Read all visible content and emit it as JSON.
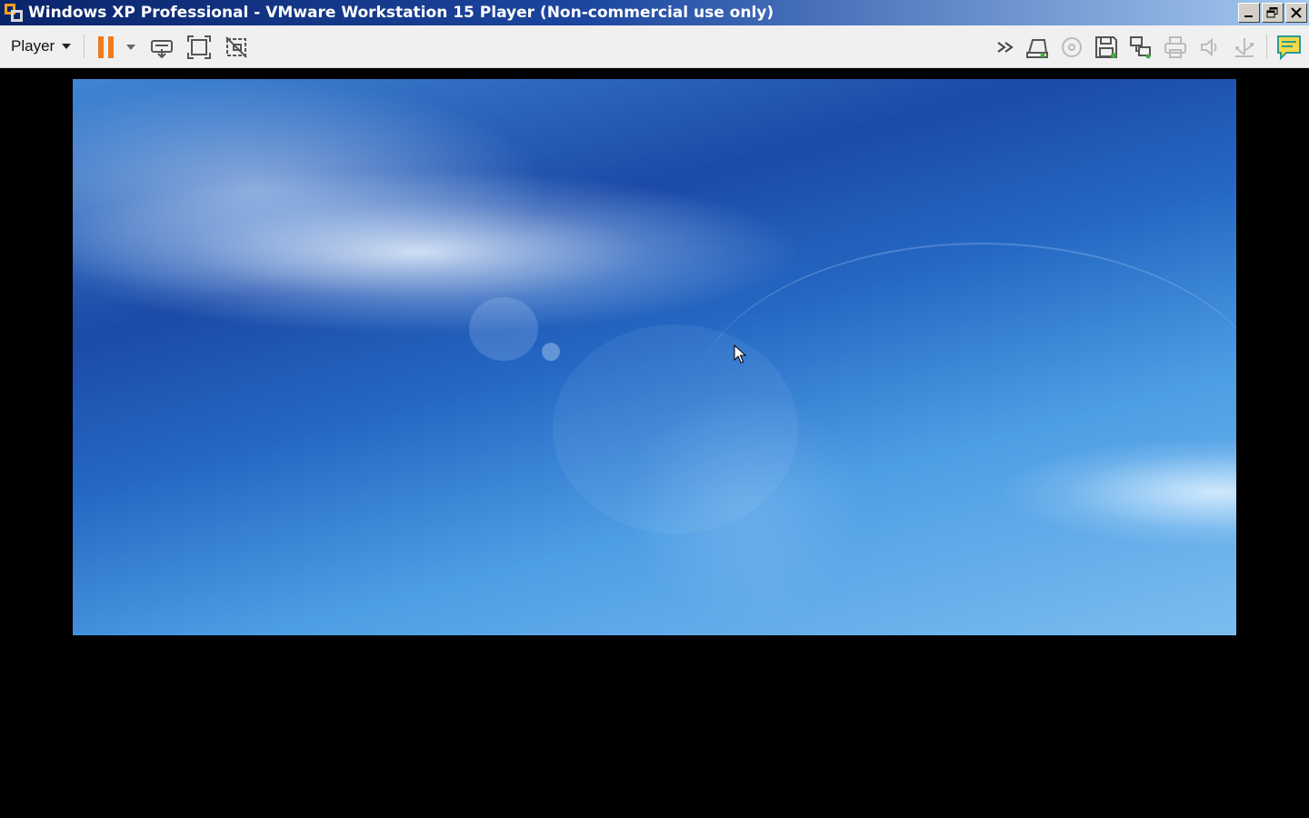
{
  "window": {
    "title": "Windows XP Professional - VMware Workstation 15 Player (Non-commercial use only)",
    "icon": "vmware-player-icon",
    "controls": [
      "minimize-icon",
      "restore-icon",
      "close-icon"
    ]
  },
  "toolbar": {
    "player_menu_label": "Player",
    "left_buttons": [
      "pause-icon",
      "dropdown-caret-icon",
      "send-ctrl-alt-del-icon",
      "full-screen-icon",
      "unity-icon"
    ],
    "right_buttons": [
      "more-devices-icon",
      "hard-disk-icon",
      "cd-dvd-icon",
      "floppy-icon",
      "network-adapter-icon",
      "printer-icon",
      "sound-card-icon",
      "usb-icon",
      "message-log-icon"
    ]
  },
  "colors": {
    "pause_accent": "#f07b1e",
    "title_bar_start": "#0a246a",
    "title_bar_end": "#a6caf0",
    "desktop_blue": "#2468c4"
  }
}
